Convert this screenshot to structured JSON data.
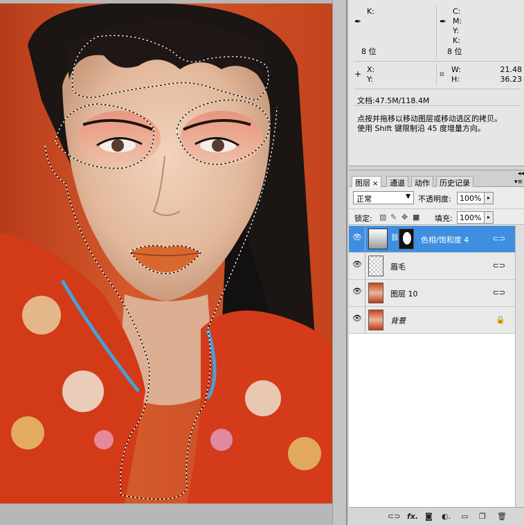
{
  "info": {
    "k_label": "K:",
    "bit_left": "8 位",
    "c_label": "C:",
    "m_label": "M:",
    "y_label": "Y:",
    "k2_label": "K:",
    "bit_right": "8 位",
    "x_label": "X:",
    "ycoord_label": "Y:",
    "w_label": "W:",
    "w_value": "21.48",
    "h_label": "H:",
    "h_value": "36.23",
    "doc_size": "文档:47.5M/118.4M",
    "hint_line1": "点按并拖移以移动图层或移动选区的拷贝。",
    "hint_line2": "使用 Shift 键限制沿 45 度增量方向。"
  },
  "layers_panel": {
    "tabs": [
      {
        "label": "图层",
        "close": "×"
      },
      {
        "label": "通道"
      },
      {
        "label": "动作"
      },
      {
        "label": "历史记录"
      }
    ],
    "blend_mode": "正常",
    "opacity_label": "不透明度:",
    "opacity_value": "100%",
    "lock_label": "锁定:",
    "fill_label": "填充:",
    "fill_value": "100%",
    "layers": [
      {
        "name": "色相/饱和度 4",
        "active": true,
        "badge": "link"
      },
      {
        "name": "眉毛",
        "active": false,
        "badge": "link"
      },
      {
        "name": "图层 10",
        "active": false,
        "badge": "link"
      },
      {
        "name": "背景",
        "active": false,
        "badge": "lock"
      }
    ]
  },
  "colors": {
    "active_layer": "#3f8fe0",
    "panel_bg": "#ececec"
  },
  "icons": [
    "eyedropper-icon",
    "crosshair-icon",
    "dimension-icon",
    "eye-icon",
    "chain-icon",
    "lock-icon",
    "fx-icon",
    "mask-icon",
    "adjustment-icon",
    "folder-icon",
    "new-layer-icon",
    "trash-icon"
  ]
}
